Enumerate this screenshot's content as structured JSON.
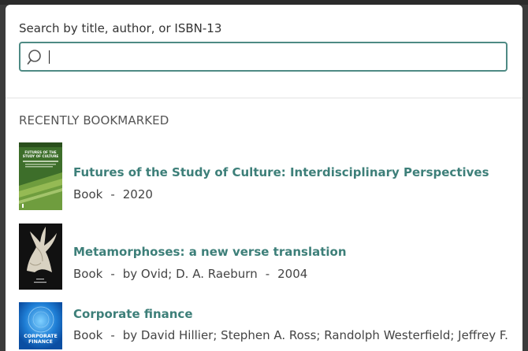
{
  "search": {
    "label": "Search by title, author, or ISBN-13",
    "value": ""
  },
  "recent": {
    "heading": "RECENTLY BOOKMARKED",
    "items": [
      {
        "title": "Futures of the Study of Culture: Interdisciplinary Perspectives",
        "type": "Book",
        "authors": "",
        "year": "2020",
        "cover_text": "FUTURES OF THE STUDY OF CULTURE"
      },
      {
        "title": "Metamorphoses: a new verse translation",
        "type": "Book",
        "authors": "by Ovid; D. A. Raeburn",
        "year": "2004"
      },
      {
        "title": "Corporate finance",
        "type": "Book",
        "authors": "by David Hillier; Stephen A. Ross; Randolph Westerfield; Jeffrey F.",
        "year": "",
        "cover_text": "CORPORATE FINANCE"
      }
    ],
    "separator": "-"
  },
  "colors": {
    "accent": "#3d7f79",
    "search_border": "#4e8a84",
    "backdrop": "#3b3b3b"
  }
}
